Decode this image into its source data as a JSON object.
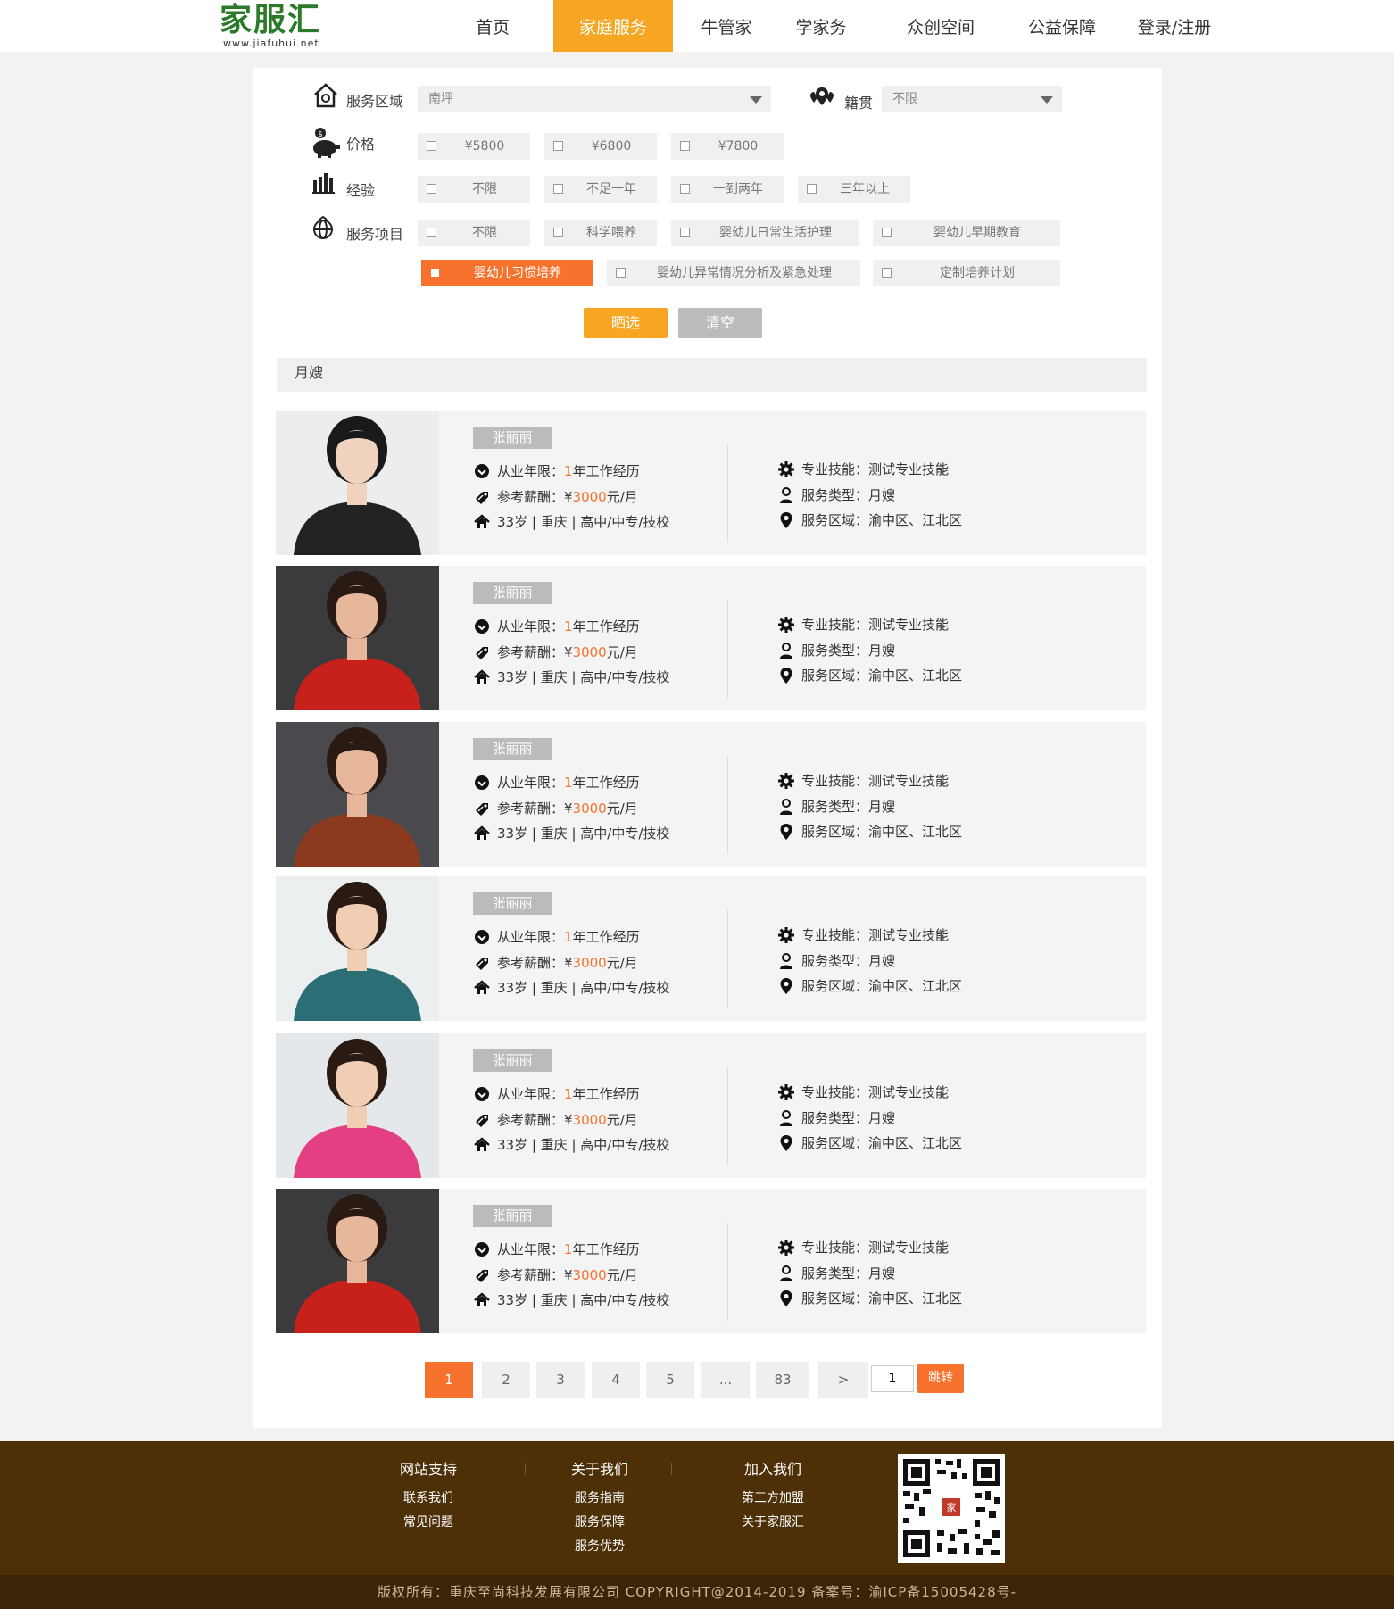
{
  "header": {
    "logo_cn": "家服汇",
    "logo_en": "www.jiafuhui.net",
    "nav": [
      {
        "label": "首页",
        "active": false
      },
      {
        "label": "家庭服务",
        "active": true
      },
      {
        "label": "牛管家",
        "active": false
      },
      {
        "label": "学家务",
        "active": false
      },
      {
        "label": "众创空间",
        "active": false
      },
      {
        "label": "公益保障",
        "active": false
      },
      {
        "label": "登录/注册",
        "active": false
      }
    ]
  },
  "filters": {
    "area": {
      "label": "服务区域",
      "value": "南坪"
    },
    "origin": {
      "label": "籍贯",
      "value": "不限"
    },
    "price": {
      "label": "价格",
      "options": [
        "¥5800",
        "¥6800",
        "¥7800"
      ]
    },
    "experience": {
      "label": "经验",
      "options": [
        "不限",
        "不足一年",
        "一到两年",
        "三年以上"
      ]
    },
    "service": {
      "label": "服务项目",
      "options_row1": [
        "不限",
        "科学喂养",
        "婴幼儿日常生活护理",
        "婴幼儿早期教育"
      ],
      "options_row2": [
        "婴幼儿习惯培养",
        "婴幼儿异常情况分析及紧急处理",
        "定制培养计划"
      ],
      "active": "婴幼儿习惯培养"
    },
    "filter_button": "晒选",
    "clear_button": "清空"
  },
  "section_title": "月嫂",
  "labels": {
    "years": "从业年限：",
    "years_unit": "年工作经历",
    "salary": "参考薪酬：¥",
    "salary_unit": "元/月",
    "skill": "专业技能：",
    "type": "服务类型：",
    "area": "服务区域："
  },
  "workers": [
    {
      "name": "张丽丽",
      "years": "1",
      "salary": "3000",
      "info": "33岁 | 重庆 | 高中/中专/技校",
      "skill": "测试专业技能",
      "type": "月嫂",
      "area": "渝中区、江北区",
      "photo": "suit"
    },
    {
      "name": "张丽丽",
      "years": "1",
      "salary": "3000",
      "info": "33岁 | 重庆 | 高中/中专/技校",
      "skill": "测试专业技能",
      "type": "月嫂",
      "area": "渝中区、江北区",
      "photo": "red"
    },
    {
      "name": "张丽丽",
      "years": "1",
      "salary": "3000",
      "info": "33岁 | 重庆 | 高中/中专/技校",
      "skill": "测试专业技能",
      "type": "月嫂",
      "area": "渝中区、江北区",
      "photo": "floral"
    },
    {
      "name": "张丽丽",
      "years": "1",
      "salary": "3000",
      "info": "33岁 | 重庆 | 高中/中专/技校",
      "skill": "测试专业技能",
      "type": "月嫂",
      "area": "渝中区、江北区",
      "photo": "teal"
    },
    {
      "name": "张丽丽",
      "years": "1",
      "salary": "3000",
      "info": "33岁 | 重庆 | 高中/中专/技校",
      "skill": "测试专业技能",
      "type": "月嫂",
      "area": "渝中区、江北区",
      "photo": "pink"
    },
    {
      "name": "张丽丽",
      "years": "1",
      "salary": "3000",
      "info": "33岁 | 重庆 | 高中/中专/技校",
      "skill": "测试专业技能",
      "type": "月嫂",
      "area": "渝中区、江北区",
      "photo": "red"
    }
  ],
  "pagination": {
    "pages": [
      "1",
      "2",
      "3",
      "4",
      "5",
      "...",
      "83",
      ">"
    ],
    "current": "1",
    "jump_value": "1",
    "jump_button": "跳转"
  },
  "footer": {
    "columns": [
      {
        "title": "网站支持",
        "links": [
          "联系我们",
          "常见问题"
        ]
      },
      {
        "title": "关于我们",
        "links": [
          "服务指南",
          "服务保障",
          "服务优势"
        ]
      },
      {
        "title": "加入我们",
        "links": [
          "第三方加盟",
          "关于家服汇"
        ]
      }
    ],
    "copyright": "版权所有：重庆至尚科技发展有限公司 COPYRIGHT@2014-2019 备案号：渝ICP备15005428号-"
  },
  "colors": {
    "accent": "#f6a623",
    "highlight": "#f7722c",
    "footer_bg": "#4d3008"
  },
  "icons": {
    "area": "house-icon",
    "origin": "map-pin-cluster-icon",
    "price": "piggy-bank-icon",
    "experience": "bar-chart-icon",
    "service": "globe-icon",
    "years": "check-circle-icon",
    "salary": "tag-icon",
    "info": "home-icon",
    "skill": "gear-icon",
    "type": "user-icon",
    "area_row": "location-pin-icon"
  }
}
